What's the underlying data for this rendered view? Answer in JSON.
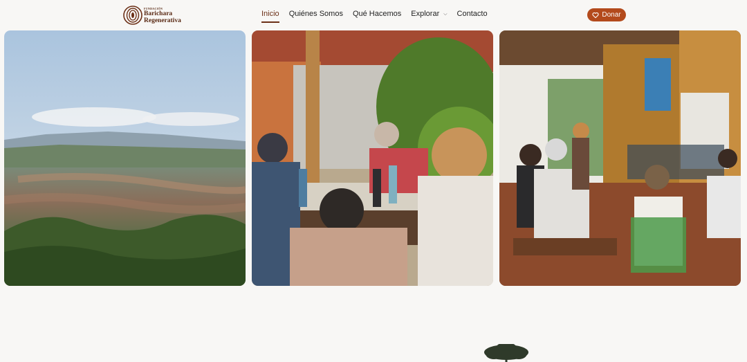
{
  "header": {
    "logo": {
      "small_text": "FUNDACIÓN",
      "line1": "Barichara",
      "line2": "Regenerativa"
    },
    "nav": [
      {
        "label": "Inicio",
        "active": true
      },
      {
        "label": "Quiénes Somos",
        "active": false
      },
      {
        "label": "Qué Hacemos",
        "active": false
      },
      {
        "label": "Explorar",
        "active": false,
        "has_dropdown": true
      },
      {
        "label": "Contacto",
        "active": false
      }
    ],
    "donate_label": "Donar",
    "donate_icon": "heart-icon"
  },
  "gallery": [
    {
      "subject": "aerial-valley-town-photo"
    },
    {
      "subject": "table-meeting-photo"
    },
    {
      "subject": "circle-gathering-photo"
    }
  ],
  "colors": {
    "brand": "#6b2f16",
    "donate": "#b34a1c",
    "background": "#f8f7f5"
  }
}
